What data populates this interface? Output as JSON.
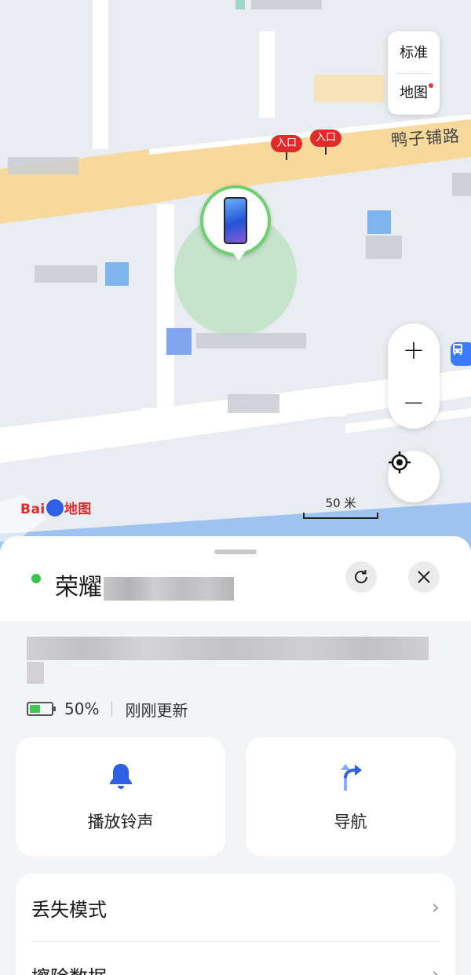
{
  "map": {
    "layer_toggle": {
      "line1": "标准",
      "line2": "地图"
    },
    "road_name": "鸭子铺路",
    "entrances": [
      "入口",
      "入口"
    ],
    "scale": "50 米",
    "logo": {
      "prefix": "Bai",
      "suffix": "地图"
    },
    "zoom_in": "+",
    "zoom_out": "−",
    "bus_icon": "bus-stop-icon"
  },
  "device": {
    "name": "荣耀",
    "online_color": "#3cc24b",
    "battery_percent": 50,
    "battery_label": "50%",
    "update_status": "刚刚更新"
  },
  "actions": {
    "ring": "播放铃声",
    "navigate": "导航"
  },
  "list": {
    "lost_mode": "丢失模式",
    "erase_data": "擦除数据"
  },
  "colors": {
    "accent": "#2f5fe3",
    "online": "#3cc24b",
    "entry": "#e12b2b"
  }
}
